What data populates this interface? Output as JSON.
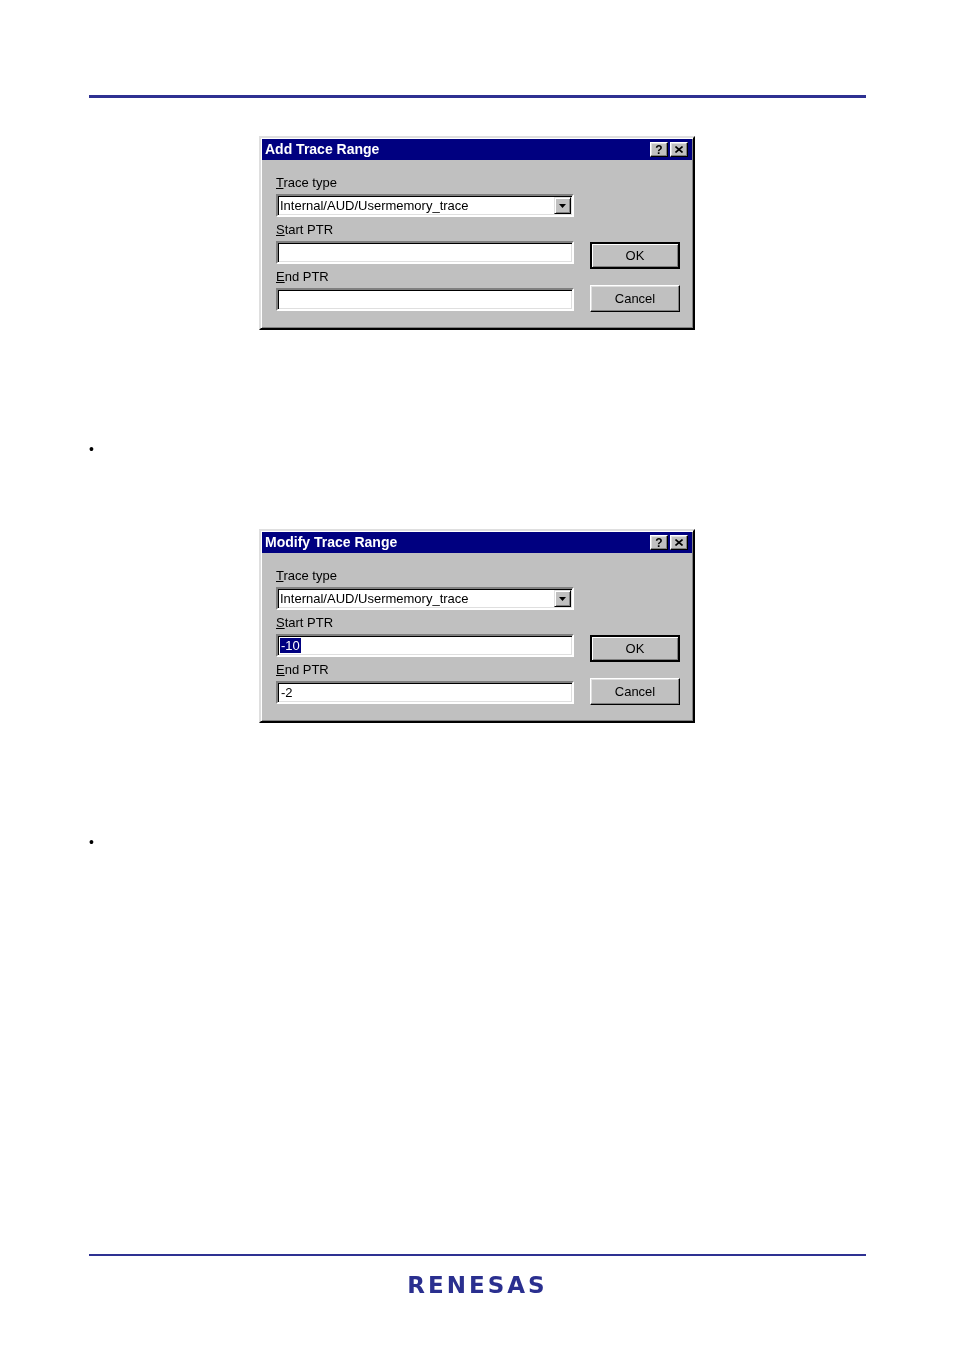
{
  "sections": [
    {
      "dialog": {
        "title": "Add Trace Range",
        "help_label": "?",
        "fields": [
          {
            "kind": "dropdown",
            "label": "Trace type",
            "value": "Internal/AUD/Usermemory_trace"
          },
          {
            "kind": "text",
            "label": "Start PTR"
          },
          {
            "kind": "text",
            "label": "End PTR"
          }
        ],
        "buttons": [
          {
            "label": "OK",
            "default": true
          },
          {
            "label": "Cancel",
            "default": false
          }
        ]
      },
      "bullet": "•"
    },
    {
      "dialog": {
        "title": "Modify Trace Range",
        "help_label": "?",
        "fields": [
          {
            "kind": "dropdown",
            "label": "Trace type",
            "value": "Internal/AUD/Usermemory_trace"
          },
          {
            "kind": "text",
            "label": "Start PTR",
            "value": "-10",
            "value_selected": true
          },
          {
            "kind": "text",
            "label": "End PTR",
            "value": "-2",
            "value_selected": false
          }
        ],
        "buttons": [
          {
            "label": "OK",
            "default": true
          },
          {
            "label": "Cancel",
            "default": false
          }
        ]
      },
      "bullet": "•"
    }
  ],
  "footer": {
    "logo": "RENESAS"
  }
}
